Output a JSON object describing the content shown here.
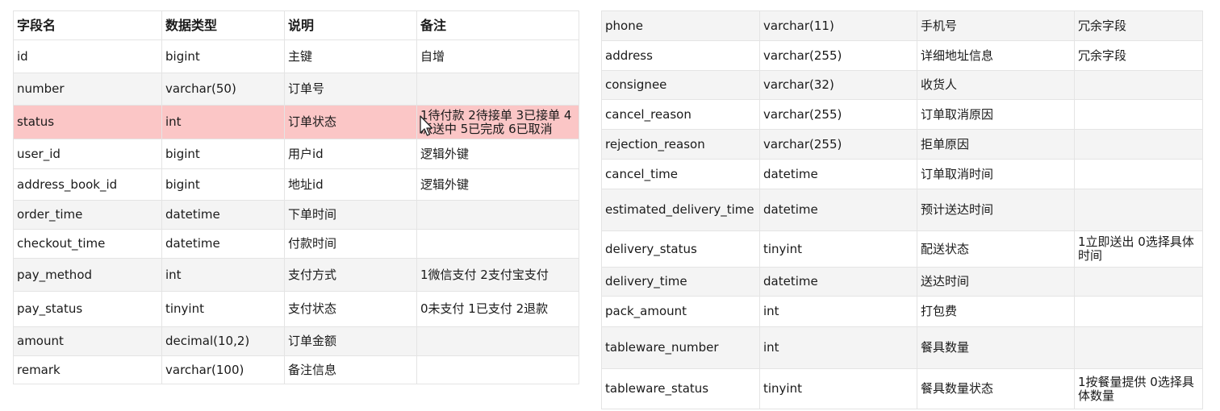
{
  "left_table": {
    "headers": [
      "字段名",
      "数据类型",
      "说明",
      "备注"
    ],
    "rows": [
      [
        "id",
        "bigint",
        "主键",
        "自增"
      ],
      [
        "number",
        "varchar(50)",
        "订单号",
        ""
      ],
      [
        "status",
        "int",
        "订单状态",
        "1待付款 2待接单 3已接单 4派送中 5已完成 6已取消"
      ],
      [
        "user_id",
        "bigint",
        "用户id",
        "逻辑外键"
      ],
      [
        "address_book_id",
        "bigint",
        "地址id",
        "逻辑外键"
      ],
      [
        "order_time",
        "datetime",
        "下单时间",
        ""
      ],
      [
        "checkout_time",
        "datetime",
        "付款时间",
        ""
      ],
      [
        "pay_method",
        "int",
        "支付方式",
        "1微信支付 2支付宝支付"
      ],
      [
        "pay_status",
        "tinyint",
        "支付状态",
        "0未支付 1已支付 2退款"
      ],
      [
        "amount",
        "decimal(10,2)",
        "订单金额",
        ""
      ],
      [
        "remark",
        "varchar(100)",
        "备注信息",
        ""
      ]
    ]
  },
  "right_table": {
    "rows": [
      [
        "phone",
        "varchar(11)",
        "手机号",
        "冗余字段"
      ],
      [
        "address",
        "varchar(255)",
        "详细地址信息",
        "冗余字段"
      ],
      [
        "consignee",
        "varchar(32)",
        "收货人",
        ""
      ],
      [
        "cancel_reason",
        "varchar(255)",
        "订单取消原因",
        ""
      ],
      [
        "rejection_reason",
        "varchar(255)",
        "拒单原因",
        ""
      ],
      [
        "cancel_time",
        "datetime",
        "订单取消时间",
        ""
      ],
      [
        "estimated_delivery_time",
        "datetime",
        "预计送达时间",
        ""
      ],
      [
        "delivery_status",
        "tinyint",
        "配送状态",
        "1立即送出 0选择具体时间"
      ],
      [
        "delivery_time",
        "datetime",
        "送达时间",
        ""
      ],
      [
        "pack_amount",
        "int",
        "打包费",
        ""
      ],
      [
        "tableware_number",
        "int",
        "餐具数量",
        ""
      ],
      [
        "tableware_status",
        "tinyint",
        "餐具数量状态",
        "1按餐量提供 0选择具体数量"
      ]
    ]
  },
  "colors": {
    "highlight_row": "#fbc6c6",
    "alt_row": "#f4f4f4",
    "border": "#e4e4e4"
  },
  "icons": {
    "cursor": "mouse-pointer-icon"
  }
}
